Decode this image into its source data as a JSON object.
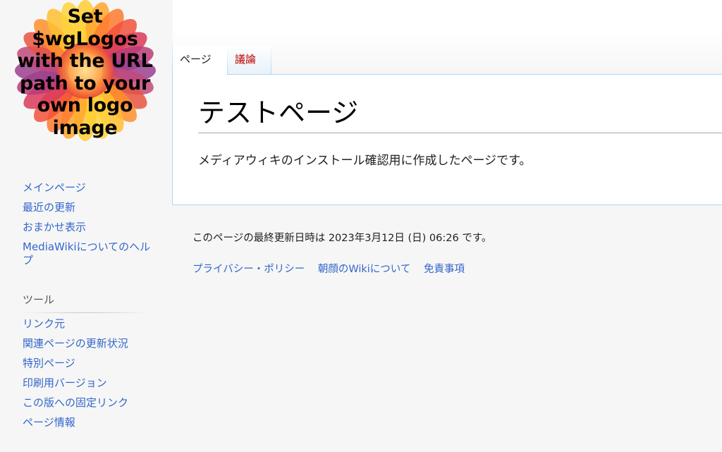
{
  "logo": {
    "lines": [
      "Set",
      "$wgLogos",
      "with the URL",
      "path to your",
      "own logo",
      "image"
    ]
  },
  "tabs": {
    "page_label": "ページ",
    "talk_label": "議論"
  },
  "content": {
    "title": "テストページ",
    "body": "メディアウィキのインストール確認用に作成したページです。"
  },
  "sidebar": {
    "navigation": [
      {
        "label": "メインページ"
      },
      {
        "label": "最近の更新"
      },
      {
        "label": "おまかせ表示"
      },
      {
        "label": "MediaWikiについてのヘルプ"
      }
    ],
    "tools_heading": "ツール",
    "tools": [
      {
        "label": "リンク元"
      },
      {
        "label": "関連ページの更新状況"
      },
      {
        "label": "特別ページ"
      },
      {
        "label": "印刷用バージョン"
      },
      {
        "label": "この版への固定リンク"
      },
      {
        "label": "ページ情報"
      }
    ]
  },
  "footer": {
    "last_modified": "このページの最終更新日時は 2023年3月12日 (日) 06:26 です。",
    "links": [
      {
        "label": "プライバシー・ポリシー"
      },
      {
        "label": "朝顔のWikiについて"
      },
      {
        "label": "免責事項"
      }
    ]
  },
  "colors": {
    "link": "#3366cc",
    "new_link": "#ba0000",
    "border": "#a7d7f9"
  }
}
